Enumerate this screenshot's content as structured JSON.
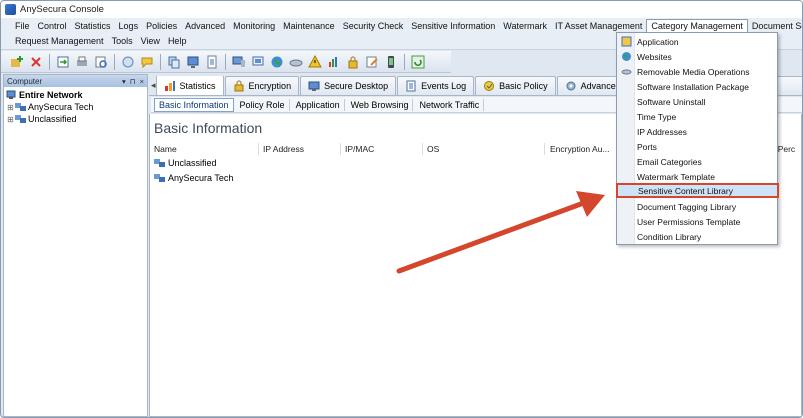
{
  "window": {
    "title": "AnySecura Console"
  },
  "menubar": {
    "items": [
      "File",
      "Control",
      "Statistics",
      "Logs",
      "Policies",
      "Advanced",
      "Monitoring",
      "Maintenance",
      "Security Check",
      "Sensitive Information",
      "Watermark",
      "IT Asset Management",
      "Category Management",
      "Document Security Mana"
    ],
    "row2": [
      "Request Management",
      "Tools",
      "View",
      "Help"
    ]
  },
  "left_panel": {
    "header": "Computer",
    "controls": [
      "▾",
      "⊓",
      "×"
    ],
    "tree": [
      "Entire Network",
      "AnySecura Tech",
      "Unclassified"
    ]
  },
  "tabs": {
    "scroll_left": "◂",
    "items": [
      "Statistics",
      "Encryption",
      "Secure Desktop",
      "Events Log",
      "Basic Policy",
      "Advanced Policy"
    ],
    "partial_right": "nce"
  },
  "subtabs": [
    "Basic Information",
    "Policy Role",
    "Application",
    "Web Browsing",
    "Network Traffic"
  ],
  "content": {
    "title": "Basic Information",
    "columns": [
      "Name",
      "IP Address",
      "IP/MAC",
      "OS",
      "Encryption Au...",
      "ual Perc"
    ],
    "rows": [
      "Unclassified",
      "AnySecura Tech"
    ]
  },
  "dropdown": {
    "items": [
      "Application",
      "Websites",
      "Removable Media Operations",
      "Software Installation Package",
      "Software Uninstall",
      "Time Type",
      "IP Addresses",
      "Ports",
      "Email Categories",
      "Watermark Template",
      "Sensitive Content Library",
      "Document Tagging Library",
      "User Permissions Template",
      "Condition Library"
    ],
    "highlighted_index": 10
  },
  "colors": {
    "highlight_border": "#d5472c",
    "arrow": "#d5472c",
    "selection": "#cfe3f8"
  }
}
